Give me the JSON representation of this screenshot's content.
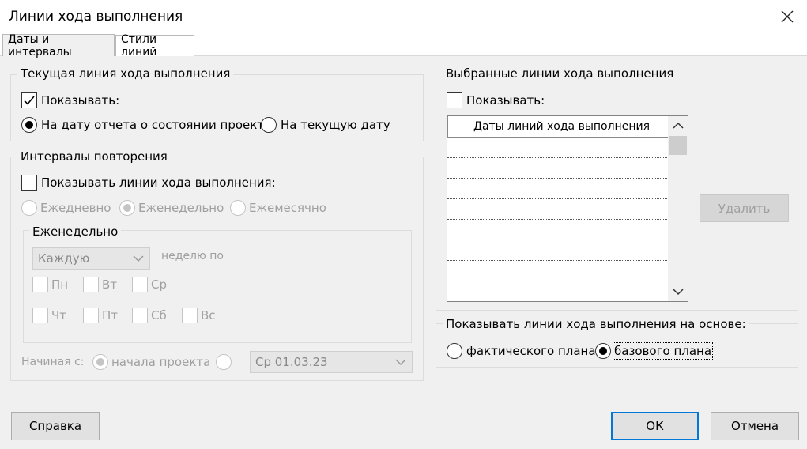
{
  "window": {
    "title": "Линии хода выполнения"
  },
  "tabs": [
    {
      "label": "Даты и интервалы",
      "active": true
    },
    {
      "label": "Стили линий",
      "active": false
    }
  ],
  "current_line": {
    "title": "Текущая линия хода выполнения",
    "show_label": "Показывать:",
    "show_checked": true,
    "radio_status_date": "На дату отчета о состоянии проекта",
    "radio_current_date": "На текущую дату",
    "selected": "status_date"
  },
  "intervals": {
    "title": "Интервалы повторения",
    "show_label": "Показывать линии хода выполнения:",
    "show_checked": false,
    "daily": "Ежедневно",
    "weekly": "Еженедельно",
    "monthly": "Ежемесячно",
    "selected": "weekly",
    "weekly_group": {
      "title": "Еженедельно",
      "every_value": "Каждую",
      "week_on": "неделю по",
      "days": [
        "Пн",
        "Вт",
        "Ср",
        "Чт",
        "Пт",
        "Сб",
        "Вс"
      ]
    },
    "start_label": "Начиная с:",
    "start_project": "начала проекта",
    "start_date": "Ср 01.03.23"
  },
  "selected_lines": {
    "title": "Выбранные линии хода выполнения",
    "show_label": "Показывать:",
    "show_checked": false,
    "column_header": "Даты линий хода выполнения",
    "delete_button": "Удалить"
  },
  "basis": {
    "title": "Показывать линии хода выполнения на основе:",
    "actual": "фактического плана",
    "baseline": "базового плана",
    "selected": "baseline"
  },
  "buttons": {
    "help": "Справка",
    "ok": "ОК",
    "cancel": "Отмена"
  },
  "icons": {
    "close": "close-icon",
    "check": "checkmark-icon",
    "dropdown": "chevron-down-icon",
    "scroll_up": "chevron-up-icon",
    "scroll_down": "chevron-down-icon"
  }
}
